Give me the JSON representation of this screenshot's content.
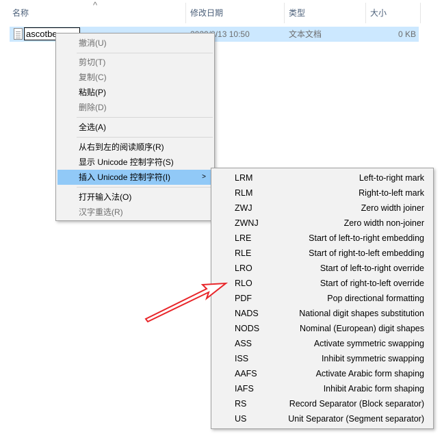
{
  "header": {
    "col_name": "名称",
    "col_modified": "修改日期",
    "col_type": "类型",
    "col_size": "大小",
    "sort_indicator": "^"
  },
  "file": {
    "name_value": "ascotbe",
    "modified": "2020/8/13 10:50",
    "type": "文本文档",
    "size": "0 KB",
    "icon": "text-document-icon"
  },
  "context_menu": {
    "undo": "撤消(U)",
    "cut": "剪切(T)",
    "copy": "复制(C)",
    "paste": "粘贴(P)",
    "delete": "删除(D)",
    "select_all": "全选(A)",
    "rtl_order": "从右到左的阅读顺序(R)",
    "show_unicode": "显示 Unicode 控制字符(S)",
    "insert_unicode": "插入 Unicode 控制字符(I)",
    "submenu_arrow": ">",
    "open_ime": "打开输入法(O)",
    "reconversion": "汉字重选(R)"
  },
  "submenu": {
    "items": [
      {
        "code": "LRM",
        "desc": "Left-to-right mark"
      },
      {
        "code": "RLM",
        "desc": "Right-to-left mark"
      },
      {
        "code": "ZWJ",
        "desc": "Zero width joiner"
      },
      {
        "code": "ZWNJ",
        "desc": "Zero width non-joiner"
      },
      {
        "code": "LRE",
        "desc": "Start of left-to-right embedding"
      },
      {
        "code": "RLE",
        "desc": "Start of right-to-left embedding"
      },
      {
        "code": "LRO",
        "desc": "Start of left-to-right override"
      },
      {
        "code": "RLO",
        "desc": "Start of right-to-left override"
      },
      {
        "code": "PDF",
        "desc": "Pop directional formatting"
      },
      {
        "code": "NADS",
        "desc": "National digit shapes substitution"
      },
      {
        "code": "NODS",
        "desc": "Nominal (European) digit shapes"
      },
      {
        "code": "ASS",
        "desc": "Activate symmetric swapping"
      },
      {
        "code": "ISS",
        "desc": "Inhibit symmetric swapping"
      },
      {
        "code": "AAFS",
        "desc": "Activate Arabic form shaping"
      },
      {
        "code": "IAFS",
        "desc": "Inhibit Arabic form shaping"
      },
      {
        "code": "RS",
        "desc": "Record Separator (Block separator)"
      },
      {
        "code": "US",
        "desc": "Unit Separator (Segment separator)"
      }
    ]
  },
  "colors": {
    "selection": "#cce8ff",
    "menu_bg": "#f2f2f2",
    "menu_highlight": "#91c9f7",
    "annotation_arrow": "#e8262a"
  }
}
